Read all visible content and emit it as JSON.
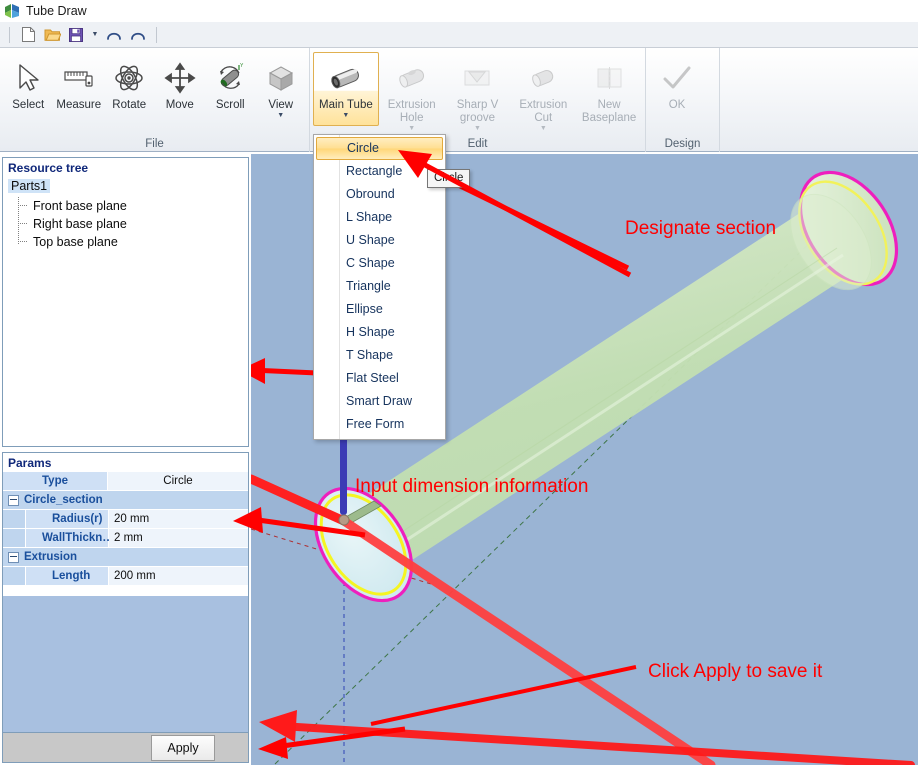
{
  "window": {
    "title": "Tube Draw",
    "logo_icon": "cube-logo-icon"
  },
  "quick_access": {
    "buttons": [
      {
        "name": "new",
        "icon": "new-document-icon"
      },
      {
        "name": "open",
        "icon": "open-folder-icon"
      },
      {
        "name": "save",
        "icon": "save-floppy-icon"
      },
      {
        "name": "save-dropdown",
        "icon": "chevron-down-icon"
      },
      {
        "name": "undo",
        "icon": "undo-arrow-icon"
      },
      {
        "name": "redo",
        "icon": "redo-arrow-icon"
      }
    ]
  },
  "ribbon": {
    "groups": [
      {
        "label": "File",
        "buttons": [
          {
            "label": "Select",
            "icon": "cursor-arrow-icon",
            "enabled": true,
            "dropdown": false
          },
          {
            "label": "Measure",
            "icon": "ruler-icon",
            "enabled": true,
            "dropdown": false
          },
          {
            "label": "Rotate",
            "icon": "rotate-orbit-icon",
            "enabled": true,
            "dropdown": false
          },
          {
            "label": "Move",
            "icon": "move-cross-icon",
            "enabled": true,
            "dropdown": false
          },
          {
            "label": "Scroll",
            "icon": "scroll-tube-icon",
            "enabled": true,
            "dropdown": false
          },
          {
            "label": "View",
            "icon": "view-cube-icon",
            "enabled": true,
            "dropdown": true
          }
        ]
      },
      {
        "label": "Edit",
        "buttons": [
          {
            "label": "Main Tube",
            "icon": "main-tube-icon",
            "enabled": true,
            "dropdown": true,
            "active": true
          },
          {
            "label": "Extrusion Hole",
            "icon": "extrusion-hole-icon",
            "enabled": false,
            "dropdown": true
          },
          {
            "label": "Sharp V groove",
            "icon": "sharp-v-groove-icon",
            "enabled": false,
            "dropdown": true
          },
          {
            "label": "Extrusion Cut",
            "icon": "extrusion-cut-icon",
            "enabled": false,
            "dropdown": true
          },
          {
            "label": "New Baseplane",
            "icon": "new-baseplane-icon",
            "enabled": false,
            "dropdown": false
          }
        ]
      },
      {
        "label": "Design",
        "buttons": [
          {
            "label": "OK",
            "icon": "checkmark-icon",
            "enabled": false,
            "dropdown": false
          }
        ]
      }
    ]
  },
  "dropdown": {
    "open_for": "Main Tube",
    "selected": "Circle",
    "items": [
      "Circle",
      "Rectangle",
      "Obround",
      "L Shape",
      "U Shape",
      "C Shape",
      "Triangle",
      "Ellipse",
      "H Shape",
      "T Shape",
      "Flat Steel",
      "Smart Draw",
      "Free Form"
    ]
  },
  "tooltip": {
    "text": "Circle"
  },
  "resource_tree": {
    "title": "Resource tree",
    "root": "Parts1",
    "children": [
      "Front base plane",
      "Right base plane",
      "Top base plane"
    ]
  },
  "params": {
    "title": "Params",
    "type_row": {
      "key": "Type",
      "value": "Circle"
    },
    "groups": [
      {
        "name": "Circle_section",
        "rows": [
          {
            "key": "Radius(r)",
            "value": "20 mm"
          },
          {
            "key": "WallThickn…",
            "value": "2 mm"
          }
        ]
      },
      {
        "name": "Extrusion",
        "rows": [
          {
            "key": "Length",
            "value": "200 mm"
          }
        ]
      }
    ]
  },
  "apply": {
    "label": "Apply"
  },
  "annotations": [
    {
      "id": "designate-section",
      "text": "Designate section"
    },
    {
      "id": "input-dimension",
      "text": "Input dimension information"
    },
    {
      "id": "click-apply",
      "text": "Click Apply to save it"
    }
  ],
  "colors": {
    "viewport_background": "#9ab4d4",
    "annotation_red": "#ff0000",
    "tube_body": "#c9e0b8",
    "tube_edge_magenta": "#ee1fbe",
    "tube_edge_yellow": "#f5f522",
    "axis_x_red": "#ff2e2e",
    "axis_z_blue": "#3b3bb5",
    "panel_title_blue": "#10287a",
    "param_key_blue": "#1a4f9c",
    "ribbon_active_gold": "#ffd779"
  }
}
